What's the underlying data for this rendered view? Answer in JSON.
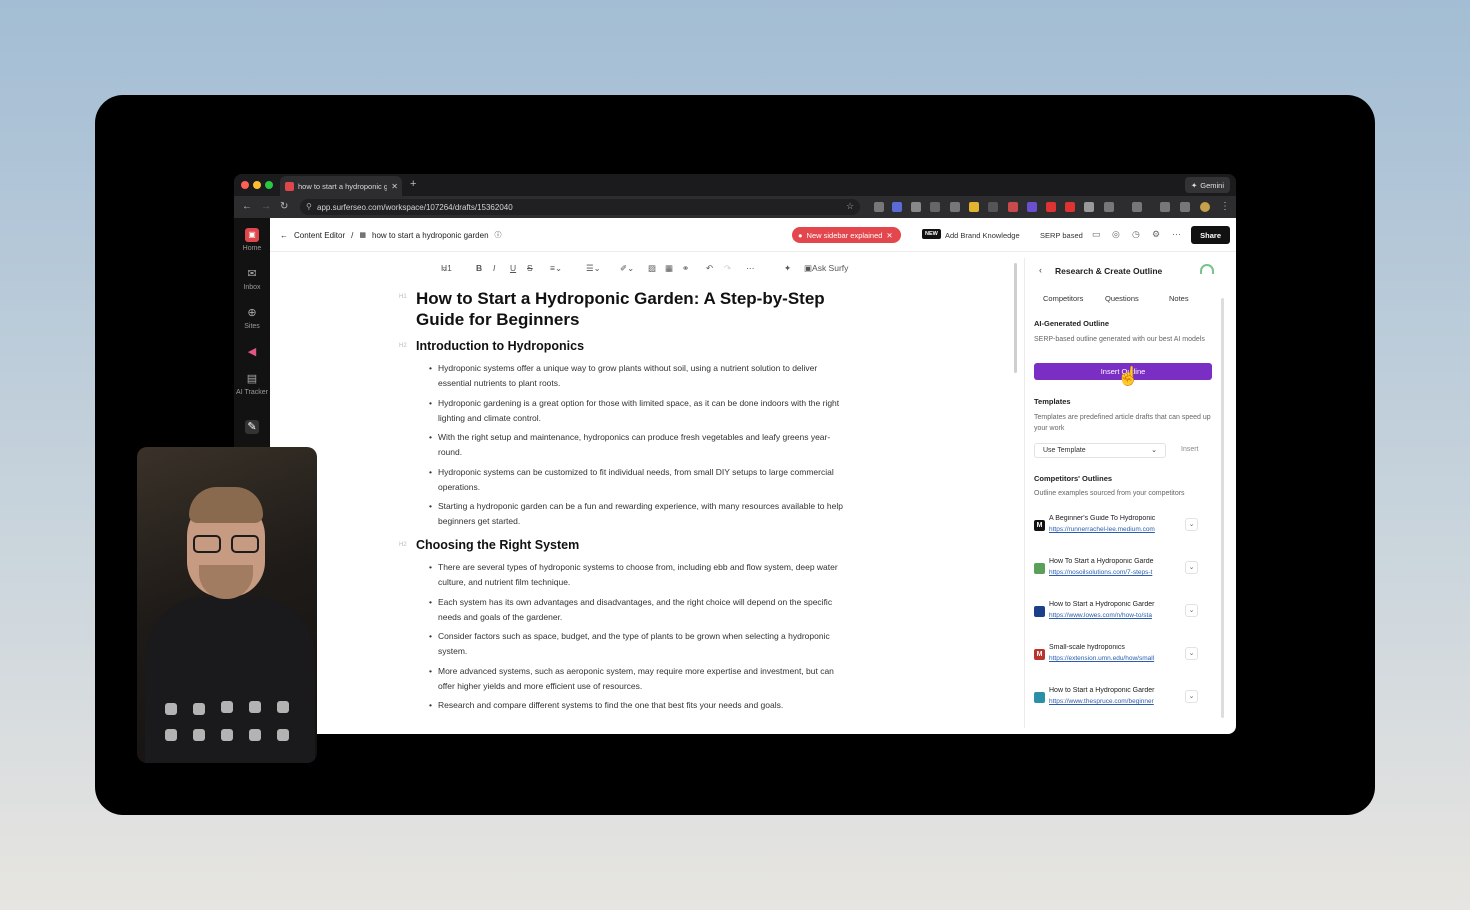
{
  "browser": {
    "tab_title": "how to start a hydroponic ga",
    "new_tab": "+",
    "gemini_label": "Gemini",
    "url": "app.surferseo.com/workspace/107264/drafts/15362040"
  },
  "sidebar": {
    "items": [
      {
        "label": "Home",
        "icon": "home-icon"
      },
      {
        "label": "Inbox",
        "icon": "inbox-icon"
      },
      {
        "label": "Sites",
        "icon": "globe-icon"
      },
      {
        "label": "",
        "icon": "megaphone-icon"
      },
      {
        "label": "AI Tracker",
        "icon": "tracker-icon"
      },
      {
        "label": "",
        "icon": "edit-icon"
      }
    ]
  },
  "topbar": {
    "breadcrumb_root": "Content Editor",
    "breadcrumb_sep": "/",
    "doc_name": "how to start a hydroponic garden",
    "announcement": "New sidebar explained",
    "new_badge": "NEW",
    "brand_knowledge": "Add Brand Knowledge",
    "serp_based": "SERP based",
    "share": "Share"
  },
  "toolbar": {
    "heading": "H1",
    "ask_surfy": "Ask Surfy"
  },
  "document": {
    "title": "How to Start a Hydroponic Garden: A Step-by-Step Guide for Beginners",
    "h1_tag": "H1",
    "h2_tag": "H2",
    "sections": [
      {
        "heading": "Introduction to Hydroponics",
        "bullets": [
          "Hydroponic systems offer a unique way to grow plants without soil, using a nutrient solution to deliver essential nutrients to plant roots.",
          "Hydroponic gardening is a great option for those with limited space, as it can be done indoors with the right lighting and climate control.",
          "With the right setup and maintenance, hydroponics can produce fresh vegetables and leafy greens year-round.",
          "Hydroponic systems can be customized to fit individual needs, from small DIY setups to large commercial operations.",
          "Starting a hydroponic garden can be a fun and rewarding experience, with many resources available to help beginners get started."
        ]
      },
      {
        "heading": "Choosing the Right System",
        "bullets": [
          "There are several types of hydroponic systems to choose from, including ebb and flow system, deep water culture, and nutrient film technique.",
          "Each system has its own advantages and disadvantages, and the right choice will depend on the specific needs and goals of the gardener.",
          "Consider factors such as space, budget, and the type of plants to be grown when selecting a hydroponic system.",
          "More advanced systems, such as aeroponic system, may require more expertise and investment, but can offer higher yields and more efficient use of resources.",
          "Research and compare different systems to find the one that best fits your needs and goals."
        ]
      }
    ]
  },
  "panel": {
    "title": "Research & Create Outline",
    "tabs": [
      "Competitors",
      "Questions",
      "Notes"
    ],
    "ai_heading": "AI-Generated Outline",
    "ai_desc": "SERP-based outline generated with our best AI models",
    "insert_outline": "Insert Outline",
    "templates_heading": "Templates",
    "templates_desc": "Templates are predefined article drafts that can speed up your work",
    "use_template": "Use Template",
    "insert": "Insert",
    "comp_heading": "Competitors' Outlines",
    "comp_desc": "Outline examples sourced from your competitors",
    "competitors": [
      {
        "title": "A Beginner's Guide To Hydroponic",
        "url": "https://runnerrachel-lee.medium.com",
        "logo": "M",
        "color": "#111111"
      },
      {
        "title": "How To Start a Hydroponic Garde",
        "url": "https://nosoilsolutions.com/7-steps-t",
        "logo": "",
        "color": "#5aa05a"
      },
      {
        "title": "How to Start a Hydroponic Garder",
        "url": "https://www.lowes.com/n/how-to/sta",
        "logo": "",
        "color": "#1d3f8a"
      },
      {
        "title": "Small-scale hydroponics",
        "url": "https://extension.umn.edu/how/small",
        "logo": "M",
        "color": "#b8342c"
      },
      {
        "title": "How to Start a Hydroponic Garder",
        "url": "https://www.thespruce.com/beginner",
        "logo": "",
        "color": "#2b8fa8"
      }
    ]
  },
  "colors": {
    "accent": "#7a2ec4",
    "alert": "#e3474d",
    "keyword_underline": "#b9cf4a"
  }
}
